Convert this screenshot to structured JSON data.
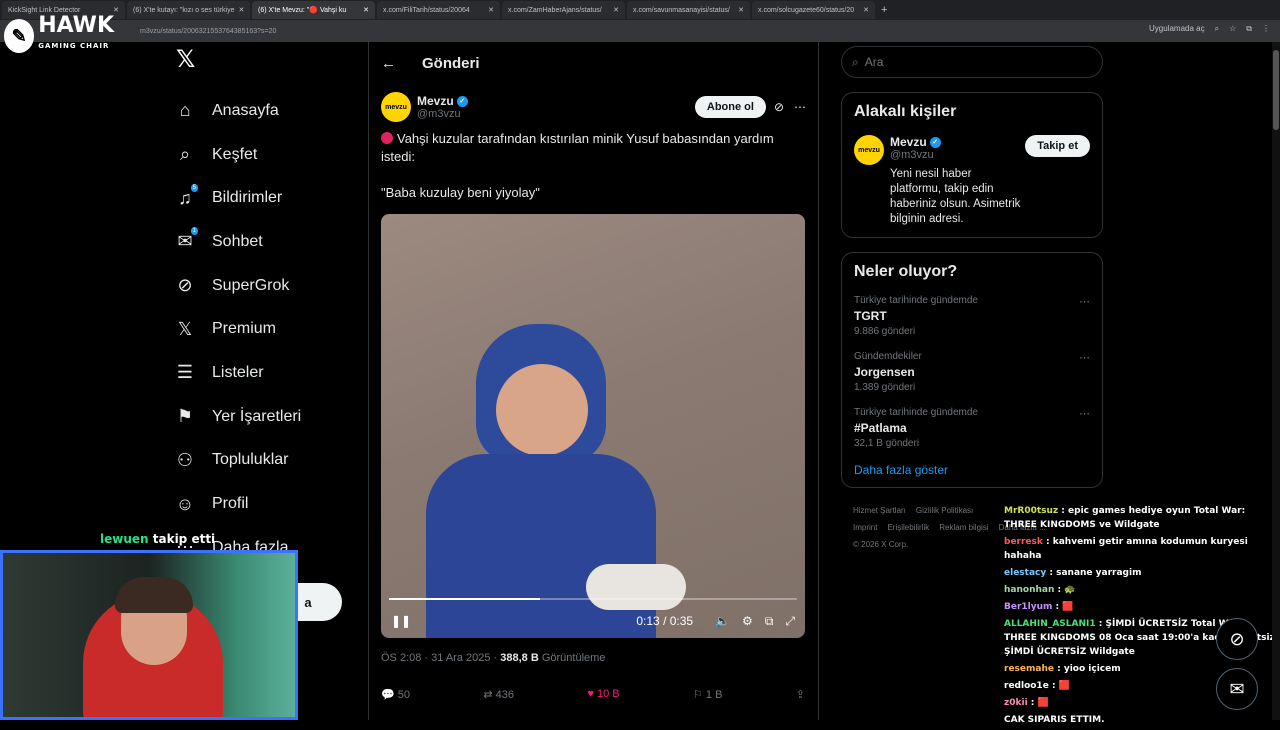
{
  "browser": {
    "tabs": [
      "KickSight Link Detector",
      "(6) X'te kutayı: \"kızı o ses türkiye",
      "(6) X'te Mevzu: \"🔴 Vahşi ku",
      "x.com/FiliTarih/status/20064",
      "x.com/ZamHaberAjans/status/",
      "x.com/savunmasanayisi/status/",
      "x.com/solcugazete60/status/20"
    ],
    "url": "m3vzu/status/2006321553764385163?s=20",
    "open_in_app": "Uygulamada aç"
  },
  "overlay": {
    "brand": "HAWK",
    "brand_sub": "GAMING CHAIR",
    "follow_name": "lewuen",
    "follow_text": "takip etti"
  },
  "sidebar": {
    "items": [
      {
        "label": "Anasayfa",
        "icon": "⌂"
      },
      {
        "label": "Keşfet",
        "icon": "⌕"
      },
      {
        "label": "Bildirimler",
        "icon": "🔔",
        "badge": "5"
      },
      {
        "label": "Sohbet",
        "icon": "✉",
        "badge": "1"
      },
      {
        "label": "SuperGrok",
        "icon": "⊘"
      },
      {
        "label": "Premium",
        "icon": "𝕏"
      },
      {
        "label": "Listeler",
        "icon": "☰"
      },
      {
        "label": "Yer İşaretleri",
        "icon": "⚑"
      },
      {
        "label": "Topluluklar",
        "icon": "👥"
      },
      {
        "label": "Profil",
        "icon": "👤"
      },
      {
        "label": "Daha fazla",
        "icon": "⋯"
      }
    ],
    "post_button": "a"
  },
  "main": {
    "header_title": "Gönderi",
    "author": {
      "name": "Mevzu",
      "handle": "@m3vzu",
      "avatar_text": "mevzu"
    },
    "subscribe": "Abone ol",
    "text_line1": "Vahşi kuzular tarafından kıstırılan minik Yusuf babasından yardım istedi:",
    "text_line2": "\"Baba kuzulay beni yiyolay\"",
    "video": {
      "time": "0:13 / 0:35",
      "progress": 0.37
    },
    "meta_date": "ÖS 2:08 · 31 Ara 2025 · ",
    "meta_views": "388,8 B",
    "meta_views_label": " Görüntüleme",
    "stats": {
      "replies": "50",
      "reposts": "436",
      "likes": "10 B",
      "bookmarks": "1 B"
    }
  },
  "right": {
    "search_placeholder": "Ara",
    "related_title": "Alakalı kişiler",
    "related": {
      "name": "Mevzu",
      "handle": "@m3vzu",
      "follow": "Takip et",
      "bio": "Yeni nesil haber platformu, takip edin haberiniz olsun. Asimetrik bilginin adresi."
    },
    "trends_title": "Neler oluyor?",
    "trends": [
      {
        "context": "Türkiye tarihinde gündemde",
        "title": "TGRT",
        "count": "9.886 gönderi"
      },
      {
        "context": "Gündemdekiler",
        "title": "Jorgensen",
        "count": "1.389 gönderi"
      },
      {
        "context": "Türkiye tarihinde gündemde",
        "title": "#Patlama",
        "count": "32,1 B gönderi"
      }
    ],
    "show_more": "Daha fazla göster",
    "footer": [
      "Hizmet Şartları",
      "Gizlilik Politikası",
      "Imprint",
      "Erişilebilirlik",
      "Reklam bilgisi",
      "Daha fazla ...",
      "© 2026 X Corp."
    ]
  },
  "chat": [
    {
      "user": "MrR00tsuz",
      "msg": "epic games hediye oyun Total War: THREE KINGDOMS ve Wildgate"
    },
    {
      "user": "berresk",
      "msg": "kahvemi getir amına kodumun kuryesi hahaha"
    },
    {
      "user": "elestacy",
      "msg": "sanane yarragim"
    },
    {
      "user": "hanonhan",
      "msg": "🐢"
    },
    {
      "user": "Ber1lyum",
      "msg": "🟥"
    },
    {
      "user": "ALLAHIN_ASLANI1",
      "msg": "ŞİMDİ ÜCRETSİZ Total War: THREE KINGDOMS 08 Oca saat 19:00'a kadar ücretsiz ŞİMDİ ÜCRETSİZ Wildgate"
    },
    {
      "user": "resemahe",
      "msg": "yioo içicem"
    },
    {
      "user": "redloo1e",
      "msg": "🟥"
    },
    {
      "user": "z0kii",
      "msg": "🟥"
    },
    {
      "user": "",
      "msg": "CAK SIPARIS ETTIM."
    }
  ]
}
